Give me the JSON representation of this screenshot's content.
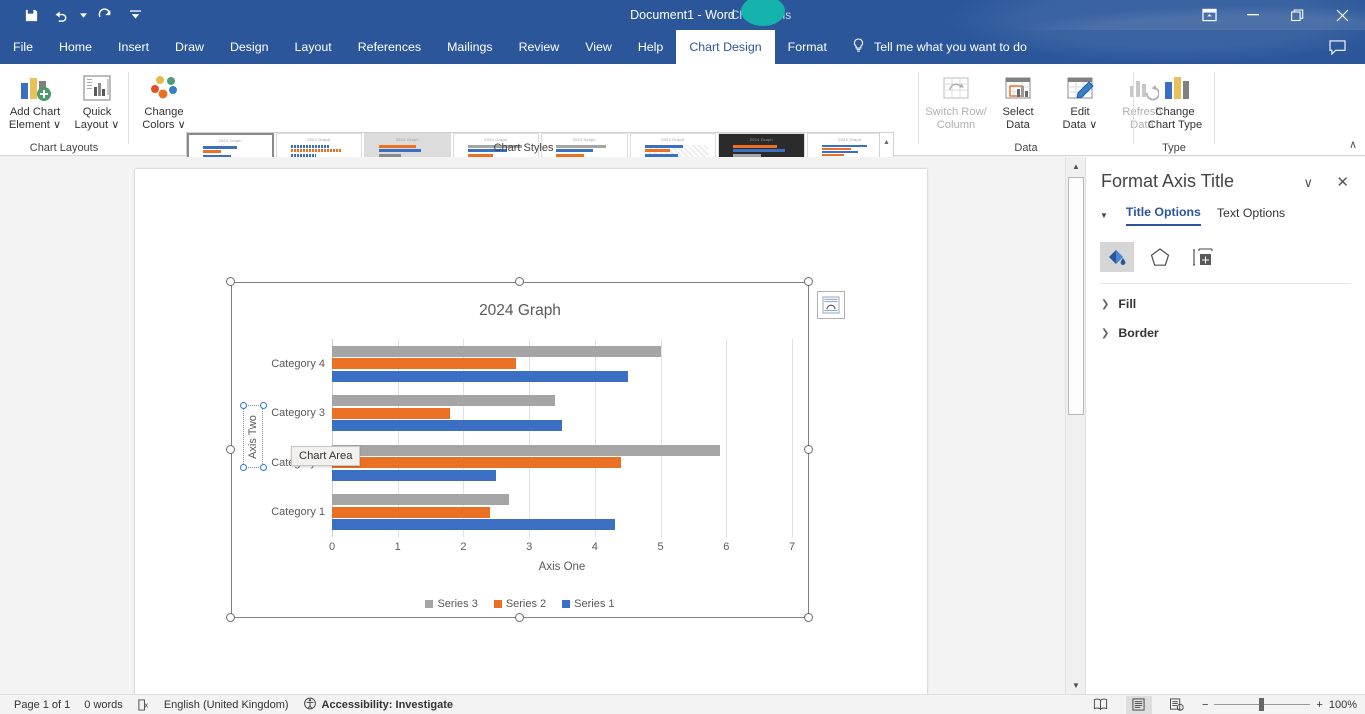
{
  "titlebar": {
    "document_title": "Document1  -  Word",
    "context_tools": "Chart Tools",
    "quick_access": [
      {
        "name": "save",
        "label": "Save"
      },
      {
        "name": "undo",
        "label": "Undo"
      },
      {
        "name": "redo",
        "label": "Redo"
      },
      {
        "name": "customize-qat",
        "label": "Customize Quick Access Toolbar"
      }
    ],
    "window": {
      "ribbon_display": "Ribbon Display Options",
      "minimize": "Minimize",
      "restore": "Restore Down",
      "close": "Close"
    }
  },
  "tabs": [
    {
      "label": "File",
      "active": false
    },
    {
      "label": "Home",
      "active": false
    },
    {
      "label": "Insert",
      "active": false
    },
    {
      "label": "Draw",
      "active": false
    },
    {
      "label": "Design",
      "active": false
    },
    {
      "label": "Layout",
      "active": false
    },
    {
      "label": "References",
      "active": false
    },
    {
      "label": "Mailings",
      "active": false
    },
    {
      "label": "Review",
      "active": false
    },
    {
      "label": "View",
      "active": false
    },
    {
      "label": "Help",
      "active": false
    },
    {
      "label": "Chart Design",
      "active": true
    },
    {
      "label": "Format",
      "active": false
    }
  ],
  "tellme": {
    "label": "Tell me what you want to do"
  },
  "comment": {
    "label": "Comments"
  },
  "ribbon": {
    "groups": [
      {
        "name": "chart-layouts",
        "label": "Chart Layouts"
      },
      {
        "name": "chart-styles",
        "label": "Chart Styles"
      },
      {
        "name": "data",
        "label": "Data"
      },
      {
        "name": "type",
        "label": "Type"
      }
    ],
    "chart_layouts": [
      {
        "name": "add-chart-element",
        "line1": "Add Chart",
        "line2": "Element ∨",
        "disabled": false
      },
      {
        "name": "quick-layout",
        "line1": "Quick",
        "line2": "Layout ∨",
        "disabled": false
      }
    ],
    "change_colors": {
      "line1": "Change",
      "line2": "Colors ∨"
    },
    "data_buttons": [
      {
        "name": "switch-row-column",
        "line1": "Switch Row/",
        "line2": "Column",
        "disabled": true
      },
      {
        "name": "select-data",
        "line1": "Select",
        "line2": "Data",
        "disabled": false
      },
      {
        "name": "edit-data",
        "line1": "Edit",
        "line2": "Data ∨",
        "disabled": false
      },
      {
        "name": "refresh-data",
        "line1": "Refresh",
        "line2": "Data",
        "disabled": true
      }
    ],
    "change_chart_type": {
      "line1": "Change",
      "line2": "Chart Type"
    },
    "collapse": "∧",
    "gallery_scroll": {
      "up": "▲",
      "down": "▼",
      "more": "▬"
    }
  },
  "chart_data": {
    "type": "bar",
    "title": "2024 Graph",
    "orientation": "horizontal",
    "xlabel": "Axis One",
    "ylabel": "Axis Two",
    "xlim": [
      0,
      7
    ],
    "xticks": [
      0,
      1,
      2,
      3,
      4,
      5,
      6,
      7
    ],
    "grid": true,
    "legend_position": "bottom",
    "categories": [
      "Category 1",
      "Category 2",
      "Category 3",
      "Category 4"
    ],
    "series": [
      {
        "name": "Series 1",
        "color": "#3a6fc4",
        "values": [
          4.3,
          2.5,
          3.5,
          4.5
        ]
      },
      {
        "name": "Series 2",
        "color": "#ea7024",
        "values": [
          2.4,
          4.4,
          1.8,
          2.8
        ]
      },
      {
        "name": "Series 3",
        "color": "#a5a5a5",
        "values": [
          2.7,
          5.9,
          3.4,
          5.0
        ]
      }
    ],
    "legend_order": [
      "Series 3",
      "Series 2",
      "Series 1"
    ]
  },
  "chart_object": {
    "tooltip": "Chart Area",
    "layout_options": "Layout Options",
    "axis_title_selected": "Axis Two"
  },
  "pane": {
    "title": "Format Axis Title",
    "chevron": "∨",
    "close": "✕",
    "expander": "▼",
    "tabs": [
      {
        "label": "Title Options",
        "active": true
      },
      {
        "label": "Text Options",
        "active": false
      }
    ],
    "icon_tabs": [
      {
        "name": "fill-line-icon",
        "active": true
      },
      {
        "name": "effects-icon",
        "active": false
      },
      {
        "name": "size-properties-icon",
        "active": false
      }
    ],
    "sections": [
      {
        "label": "Fill",
        "chevron": "❯"
      },
      {
        "label": "Border",
        "chevron": "❯"
      }
    ]
  },
  "statusbar": {
    "page": "Page 1 of 1",
    "words": "0 words",
    "proofing_icon": "proofing-errors-icon",
    "language": "English (United Kingdom)",
    "accessibility": "Accessibility: Investigate",
    "views": [
      {
        "name": "read-mode",
        "active": false
      },
      {
        "name": "print-layout",
        "active": true
      },
      {
        "name": "web-layout",
        "active": false
      }
    ],
    "zoom_out": "−",
    "zoom_in": "+",
    "zoom_level": "100%"
  }
}
